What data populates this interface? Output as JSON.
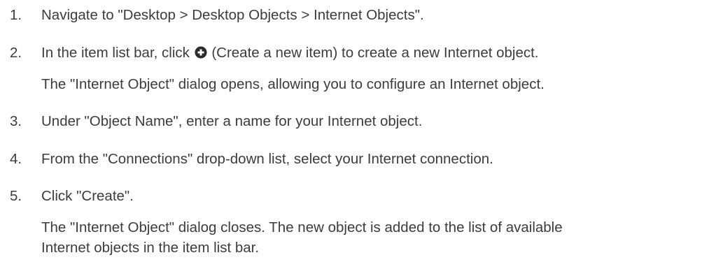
{
  "steps": [
    {
      "number": "1.",
      "text": "Navigate to \"Desktop > Desktop Objects > Internet Objects\"."
    },
    {
      "number": "2.",
      "text_before_icon": "In the item list bar, click",
      "icon": "plus-circle-icon",
      "text_after_icon": "(Create a new item) to create a new Internet object.",
      "result": "The \"Internet Object\" dialog opens, allowing you to configure an Internet object."
    },
    {
      "number": "3.",
      "text": "Under \"Object Name\", enter a name for your Internet object."
    },
    {
      "number": "4.",
      "text": "From the \"Connections\" drop-down list, select your Internet connection."
    },
    {
      "number": "5.",
      "text": "Click \"Create\".",
      "result_line1": "The \"Internet Object\" dialog closes. The new object is added to the list of available",
      "result_line2": "Internet objects in the item list bar."
    }
  ]
}
